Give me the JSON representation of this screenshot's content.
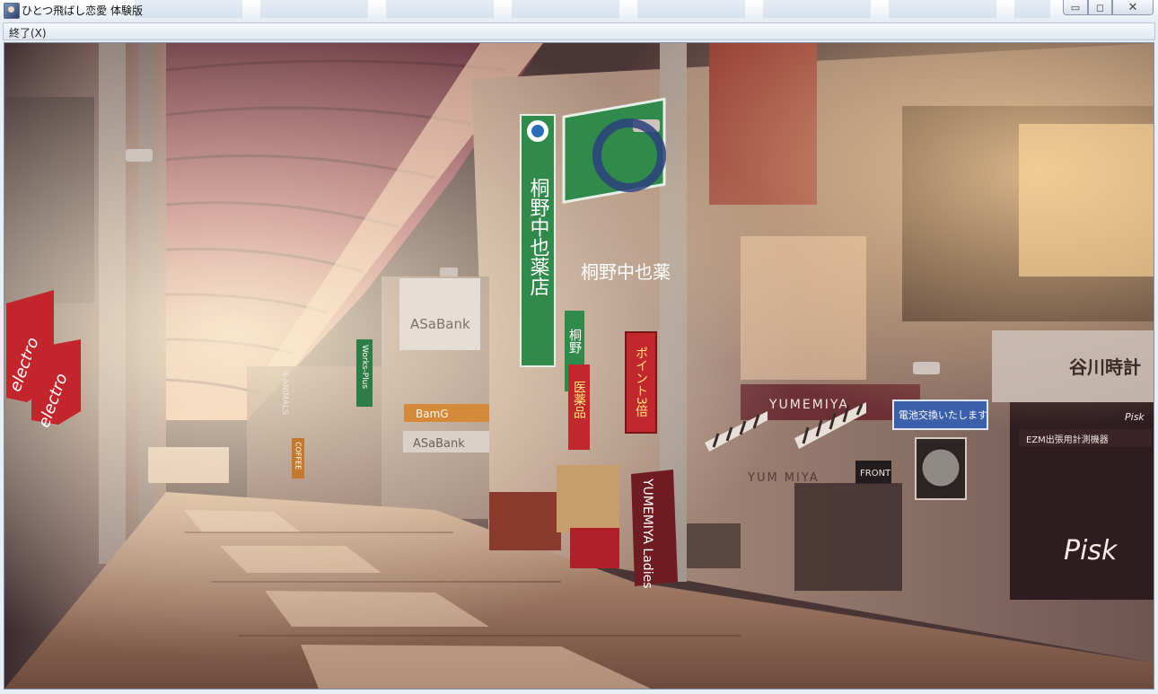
{
  "window": {
    "title": "ひとつ飛ばし恋愛 体験版",
    "controls": {
      "minimize": "▭",
      "maximize": "◻",
      "close": "✕"
    }
  },
  "menu": {
    "items": [
      {
        "label": "終了(X)"
      }
    ]
  },
  "scene": {
    "signs": {
      "drugstore_vertical": "桐野中也薬店",
      "drugstore_horizontal": "桐野中也薬",
      "drugstore_small": "桐野",
      "point_banner": "ポイント3倍",
      "medicine_banner": "医薬品",
      "asabank_upper": "ASaBank",
      "asabank_lower": "ASaBank",
      "works_plus": "Works-Plus",
      "four_animals": "4 ANIMALS",
      "yumemiya_main": "YUMEMIYA",
      "yumemiya_lower": "YUM  MIYA",
      "battery_sign": "電池交換いたします",
      "watch_shop": "谷川時計",
      "ezm_sign": "EZM出張用計測機器",
      "pisk": "Pisk",
      "front": "FRONT",
      "electro_1": "electro",
      "electro_2": "electro",
      "coffee": "COFFEE",
      "yumemiya_ladies": "YUMEMIYA Ladies",
      "pisk_small": "Pisk",
      "bamg": "BamG"
    }
  }
}
